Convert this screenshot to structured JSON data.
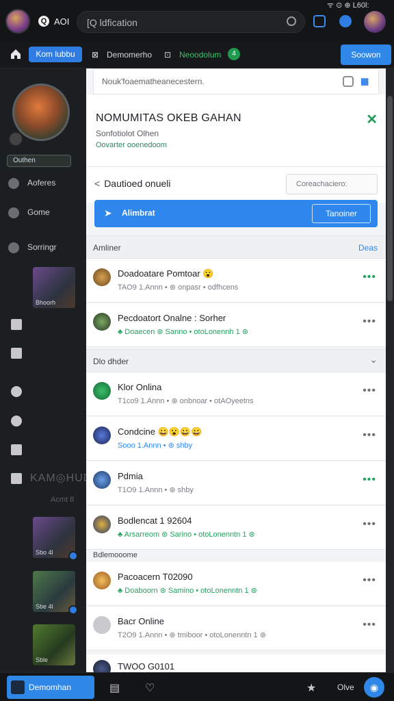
{
  "topbar": {
    "label": "AOI",
    "search_text": "[Q ldfication",
    "status": "ᯤ ⊙ ⊕ L60l:"
  },
  "nav": {
    "tabs": [
      {
        "label": "Kom lubbu",
        "active": true
      },
      {
        "label": "Demomerho",
        "active": false
      },
      {
        "label": "Neoodolum",
        "active": false
      }
    ],
    "green_badge": "4",
    "action_button": "Soowon"
  },
  "sidebar": {
    "pill": "Outhen",
    "items": [
      "Aoferes",
      "Gome",
      "Sorringr"
    ],
    "thumb_labels": [
      "Bhoorh",
      "Sbo 4l",
      "Sbe 4l",
      "Sble"
    ],
    "faint_title": "KAM◎HUD",
    "faint_sub": "Acmt 8"
  },
  "panel": {
    "filter_placeholder": "Nouk'foaematheanecestern.",
    "card": {
      "title": "NOMUMITAS OKEB GAHAN",
      "subtitle": "Sonfotiolot Olhen",
      "subtitle2": "Oovarter ooenedoom"
    },
    "input_row": {
      "label": "Dautioed onueli",
      "box": "Coreachaciero:"
    },
    "blue_bar": {
      "label": "Alimbrat",
      "button": "Tanoiner"
    },
    "sections": [
      {
        "title": "Amliner",
        "right": "Deas"
      },
      {
        "title": "Dlo dhder",
        "right": ""
      },
      {
        "title": "Bdlemooome",
        "right": ""
      }
    ],
    "items": [
      {
        "name": "Doadoatare Pomtoar 😮",
        "meta": "TAO9 1.Annn • ⊛ onpasr • odfhcens",
        "meta_green": false,
        "more_green": true
      },
      {
        "name": "Pecdoatort Onalne : Sorher",
        "meta": "♣ Doaecen ⊛ Sanno • otoLonennh 1 ⊛",
        "meta_green": true,
        "more_green": false
      },
      {
        "name": "Klor Onlina",
        "meta": "T1co9 1.Annn • ⊛ onbnoar • otAOyeetns",
        "meta_green": false,
        "more_green": false
      },
      {
        "name": "Condcine 😀😮😀😀",
        "meta": "Sooo 1.Annn • ⊛ shby",
        "meta_green": false,
        "more_green": false
      },
      {
        "name": "Pdmia",
        "meta": "T1O9 1.Annn • ⊛ shby",
        "meta_green": false,
        "more_green": true
      },
      {
        "name": "Bodlencat 1 92604",
        "meta": "♣ Arsarreom ⊛ Sarino • otoLonenntn 1 ⊛",
        "meta_green": true,
        "more_green": false
      },
      {
        "name": "Pacoacern T02090",
        "meta": "♣ Doaboorn ⊛ Samino • otoLonenntn 1 ⊛",
        "meta_green": true,
        "more_green": false
      },
      {
        "name": "Bacr Online",
        "meta": "T2O9 1.Annn • ⊛ tmiboor • otoLonenntn 1 ⊛",
        "meta_green": false,
        "more_green": false
      },
      {
        "name": "TWOO G0101",
        "meta": "",
        "meta_green": false,
        "more_green": false
      }
    ]
  },
  "bottombar": {
    "active_label": "Demomhan",
    "right_label": "Olve",
    "icons": [
      "grid-icon",
      "heart-icon",
      "star-icon",
      "chat-icon"
    ]
  },
  "colors": {
    "accent_blue": "#2f87e8",
    "green": "#23a260",
    "dark_bg": "#141517",
    "panel_bg": "#f3f4f6"
  }
}
